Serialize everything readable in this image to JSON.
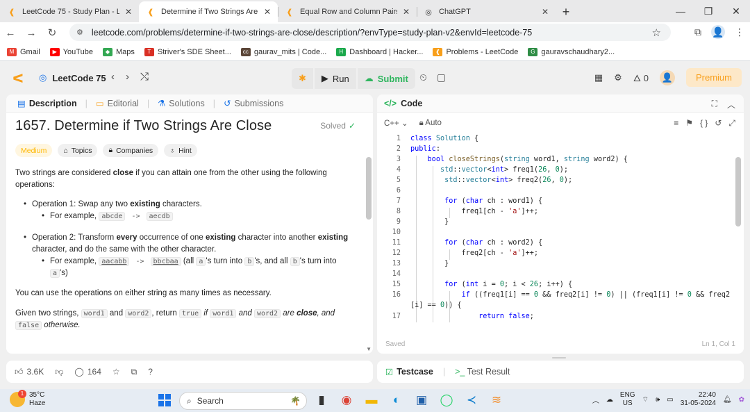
{
  "browser": {
    "tabs": [
      {
        "title": "LeetCode 75 - Study Plan - LeetCode",
        "active": false
      },
      {
        "title": "Determine if Two Strings Are Close",
        "active": true
      },
      {
        "title": "Equal Row and Column Pairs - LeetCode",
        "active": false
      },
      {
        "title": "ChatGPT",
        "active": false
      }
    ],
    "url": "leetcode.com/problems/determine-if-two-strings-are-close/description/?envType=study-plan-v2&envId=leetcode-75",
    "bookmarks": [
      "Gmail",
      "YouTube",
      "Maps",
      "Striver's SDE Sheet...",
      "gaurav_mits | Code...",
      "Dashboard | Hacker...",
      "Problems - LeetCode",
      "gauravschaudhary2..."
    ]
  },
  "header": {
    "plan": "LeetCode 75",
    "run_label": "Run",
    "submit_label": "Submit",
    "streak": "0",
    "premium_label": "Premium"
  },
  "left": {
    "tabs": [
      "Description",
      "Editorial",
      "Solutions",
      "Submissions"
    ],
    "title": "1657. Determine if Two Strings Are Close",
    "solved_label": "Solved",
    "chips": [
      "Medium",
      "Topics",
      "Companies",
      "Hint"
    ],
    "intro_a": "Two strings are considered ",
    "intro_b": "close",
    "intro_c": " if you can attain one from the other using the following operations:",
    "op1_a": "Operation 1: Swap any two ",
    "op1_b": "existing",
    "op1_c": " characters.",
    "op1_ex_a": "For example, ",
    "op1_ex_b": "abcde",
    "op1_ex_c": " -> ",
    "op1_ex_d": "aecdb",
    "op2_a": "Operation 2: Transform ",
    "op2_b": "every",
    "op2_c": " occurrence of one ",
    "op2_d": "existing",
    "op2_e": " character into another ",
    "op2_f": "existing",
    "op2_g": " character, and do the same with the other character.",
    "op2_ex_a": "For example, ",
    "op2_ex_b": "aacabb",
    "op2_ex_c": " -> ",
    "op2_ex_d": "bbcbaa",
    "op2_ex_e": " (all ",
    "op2_ex_f": "a",
    "op2_ex_g": "'s turn into ",
    "op2_ex_h": "b",
    "op2_ex_i": "'s, and all ",
    "op2_ex_j": "b",
    "op2_ex_k": "'s turn into ",
    "op2_ex_l": "a",
    "op2_ex_m": "'s)",
    "p_any": "You can use the operations on either string as many times as necessary.",
    "given_a": "Given two strings, ",
    "given_b": "word1",
    "given_c": " and ",
    "given_d": "word2",
    "given_e": ", return ",
    "given_f": "true",
    "given_g": " if ",
    "given_h": "word1",
    "given_i": " and ",
    "given_j": "word2",
    "given_k": " are ",
    "given_l": "close",
    "given_m": ", and ",
    "given_n": "false",
    "given_o": " otherwise.",
    "likes": "3.6K",
    "comments": "164"
  },
  "code": {
    "tab_label": "Code",
    "language": "C++",
    "mode": "Auto",
    "status_left": "Saved",
    "status_right": "Ln 1, Col 1",
    "lines": [
      "1",
      "2",
      "3",
      "4",
      "5",
      "6",
      "7",
      "8",
      "9",
      "10",
      "11",
      "12",
      "13",
      "14",
      "15",
      "16",
      "",
      "17"
    ]
  },
  "bottom": {
    "testcase_label": "Testcase",
    "result_label": "Test Result"
  },
  "taskbar": {
    "temp": "35°C",
    "weather": "Haze",
    "notif": "1",
    "search": "Search",
    "lang1": "ENG",
    "lang2": "US",
    "time": "22:40",
    "date": "31-05-2024"
  }
}
